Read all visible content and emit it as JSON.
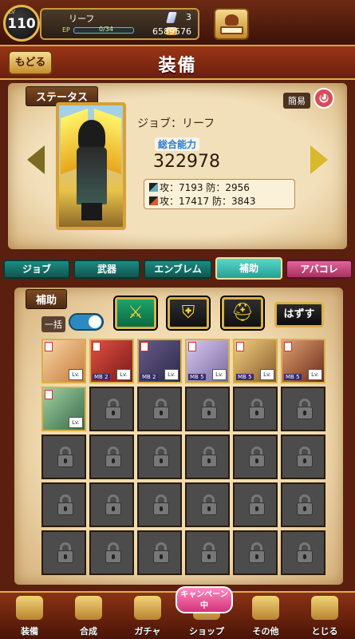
{
  "header": {
    "lv_label": "LV",
    "level": "110",
    "player_name": "リーフ",
    "ep_label": "EP",
    "ep_value": "0/34",
    "ep_fraction": 0.0,
    "gems": "3",
    "gold": "6589576"
  },
  "titlebar": {
    "back_label": "もどる",
    "title": "装備"
  },
  "status": {
    "section_label": "ステータス",
    "simple_label": "簡易",
    "job_line": "ジョブ：リーフ",
    "power_label": "総合能力",
    "power_value": "322978",
    "stats": [
      "攻：7193  防：2956",
      "攻：17417  防：3843"
    ]
  },
  "tabs": [
    {
      "label": "ジョブ",
      "active": false
    },
    {
      "label": "武器",
      "active": false
    },
    {
      "label": "エンブレム",
      "active": false
    },
    {
      "label": "補助",
      "active": true
    },
    {
      "label": "アバコレ",
      "active": false
    }
  ],
  "support": {
    "section_label": "補助",
    "bulk_label": "一括",
    "bulk_toggle_on": true,
    "remove_label": "はずす",
    "filters": [
      {
        "icon": "sword-icon",
        "active": true
      },
      {
        "icon": "armor-icon",
        "active": false
      },
      {
        "icon": "helmet-icon",
        "active": false
      }
    ],
    "cards": [
      {
        "mb": "",
        "lv": "Lv.",
        "colors": [
          "#f7d8a8",
          "#c87a3a"
        ]
      },
      {
        "mb": "MB 2",
        "lv": "Lv.",
        "colors": [
          "#e05040",
          "#7a1a1a"
        ]
      },
      {
        "mb": "MB 2",
        "lv": "Lv.",
        "colors": [
          "#6a5a8a",
          "#2a2a4a"
        ]
      },
      {
        "mb": "MB 5",
        "lv": "Lv.",
        "colors": [
          "#d8c8f0",
          "#7a6aa0"
        ]
      },
      {
        "mb": "MB 5",
        "lv": "Lv.",
        "colors": [
          "#f0d080",
          "#8a5a2a"
        ]
      },
      {
        "mb": "MB 5",
        "lv": "Lv.",
        "colors": [
          "#e0a070",
          "#6a2a1a"
        ]
      },
      {
        "mb": "",
        "lv": "Lv.",
        "colors": [
          "#a0d0a0",
          "#3a6a4a"
        ]
      }
    ],
    "total_slots": 30
  },
  "bottom_nav": [
    {
      "label": "装備",
      "icon": "equip-icon"
    },
    {
      "label": "合成",
      "icon": "hammer-icon"
    },
    {
      "label": "ガチャ",
      "icon": "gacha-icon"
    },
    {
      "label": "ショップ",
      "icon": "shop-icon"
    },
    {
      "label": "その他",
      "icon": "gear-icon"
    },
    {
      "label": "とじる",
      "icon": "close-icon"
    }
  ],
  "campaign_badge": "キャンペーン中"
}
